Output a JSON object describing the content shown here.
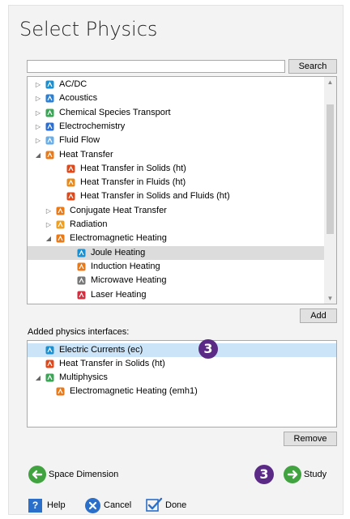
{
  "title": "Select Physics",
  "search": {
    "placeholder": "",
    "button": "Search"
  },
  "tree": [
    {
      "label": "AC/DC",
      "expander": "▷",
      "icon": "acdc-icon",
      "color": "#1a8fd1",
      "indent": 0
    },
    {
      "label": "Acoustics",
      "expander": "▷",
      "icon": "acoustics-icon",
      "color": "#2b7fd4",
      "indent": 0
    },
    {
      "label": "Chemical Species Transport",
      "expander": "▷",
      "icon": "chemical-species-icon",
      "color": "#3aa655",
      "indent": 0
    },
    {
      "label": "Electrochemistry",
      "expander": "▷",
      "icon": "electrochemistry-icon",
      "color": "#2b6fd4",
      "indent": 0
    },
    {
      "label": "Fluid Flow",
      "expander": "▷",
      "icon": "fluid-flow-icon",
      "color": "#6aaee8",
      "indent": 0
    },
    {
      "label": "Heat Transfer",
      "expander": "◢",
      "icon": "heat-transfer-icon",
      "color": "#e87a1a",
      "indent": 0
    },
    {
      "label": "Heat Transfer in Solids (ht)",
      "expander": "",
      "icon": "heat-solids-icon",
      "color": "#e0481a",
      "indent": 2
    },
    {
      "label": "Heat Transfer in Fluids (ht)",
      "expander": "",
      "icon": "heat-fluids-icon",
      "color": "#e88a1a",
      "indent": 2
    },
    {
      "label": "Heat Transfer in Solids and Fluids (ht)",
      "expander": "",
      "icon": "heat-solids-fluids-icon",
      "color": "#e0481a",
      "indent": 2
    },
    {
      "label": "Conjugate Heat Transfer",
      "expander": "▷",
      "icon": "conjugate-heat-icon",
      "color": "#e87a1a",
      "indent": 1
    },
    {
      "label": "Radiation",
      "expander": "▷",
      "icon": "radiation-icon",
      "color": "#f0a020",
      "indent": 1
    },
    {
      "label": "Electromagnetic Heating",
      "expander": "◢",
      "icon": "electromagnetic-heating-icon",
      "color": "#e87a1a",
      "indent": 1
    },
    {
      "label": "Joule Heating",
      "expander": "",
      "icon": "joule-heating-icon",
      "color": "#1a8fd1",
      "indent": 3,
      "selected": true
    },
    {
      "label": "Induction Heating",
      "expander": "",
      "icon": "induction-heating-icon",
      "color": "#e87a1a",
      "indent": 3
    },
    {
      "label": "Microwave Heating",
      "expander": "",
      "icon": "microwave-heating-icon",
      "color": "#777777",
      "indent": 3
    },
    {
      "label": "Laser Heating",
      "expander": "",
      "icon": "laser-heating-icon",
      "color": "#d03040",
      "indent": 3
    }
  ],
  "add_button": "Add",
  "added_label": "Added physics interfaces:",
  "added": [
    {
      "label": "Electric Currents (ec)",
      "expander": "",
      "icon": "electric-currents-icon",
      "color": "#1a8fd1",
      "indent": 0,
      "selected": true
    },
    {
      "label": "Heat Transfer in Solids (ht)",
      "expander": "",
      "icon": "heat-solids-icon",
      "color": "#e0481a",
      "indent": 0
    },
    {
      "label": "Multiphysics",
      "expander": "◢",
      "icon": "multiphysics-icon",
      "color": "#3aa655",
      "indent": 0
    },
    {
      "label": "Electromagnetic Heating (emh1)",
      "expander": "",
      "icon": "electromagnetic-heating-icon",
      "color": "#e87a1a",
      "indent": 1
    }
  ],
  "remove_button": "Remove",
  "badges": [
    "3",
    "3"
  ],
  "nav": {
    "back": "Space Dimension",
    "next": "Study"
  },
  "footer": {
    "help": "Help",
    "cancel": "Cancel",
    "done": "Done"
  },
  "colors": {
    "accent_green": "#41a33f",
    "badge_purple": "#5b2a86",
    "selection_blue": "#cce4f7",
    "help_blue": "#2a6fc9"
  }
}
